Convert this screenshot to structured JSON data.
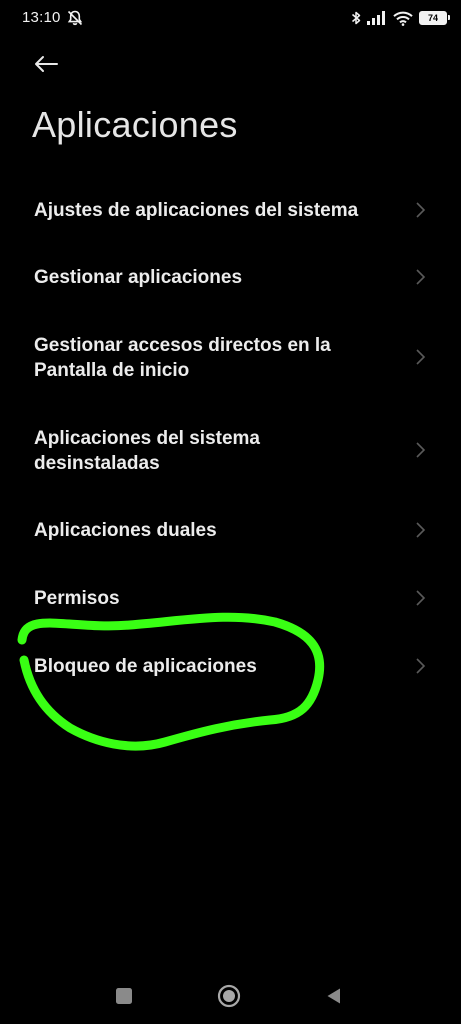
{
  "status_bar": {
    "time": "13:10",
    "battery": "74",
    "icons": [
      "dnd-off-icon",
      "bluetooth-icon",
      "signal-icon",
      "wifi-icon",
      "battery-icon"
    ]
  },
  "header": {
    "back_icon": "arrow-left-icon",
    "title": "Aplicaciones"
  },
  "items": [
    {
      "label": "Ajustes de aplicaciones del sistema"
    },
    {
      "label": "Gestionar aplicaciones"
    },
    {
      "label": "Gestionar accesos directos en la Pantalla de inicio"
    },
    {
      "label": "Aplicaciones del sistema desinstaladas"
    },
    {
      "label": "Aplicaciones duales"
    },
    {
      "label": "Permisos"
    },
    {
      "label": "Bloqueo de aplicaciones"
    }
  ],
  "annotation": {
    "color": "#39ff14",
    "target": "Bloqueo de aplicaciones"
  },
  "nav_bar": {
    "icons": [
      "recents-square-icon",
      "home-circle-icon",
      "back-triangle-icon"
    ]
  },
  "colors": {
    "background": "#000000",
    "text": "#ececec",
    "chevron": "#5a5a5a"
  }
}
